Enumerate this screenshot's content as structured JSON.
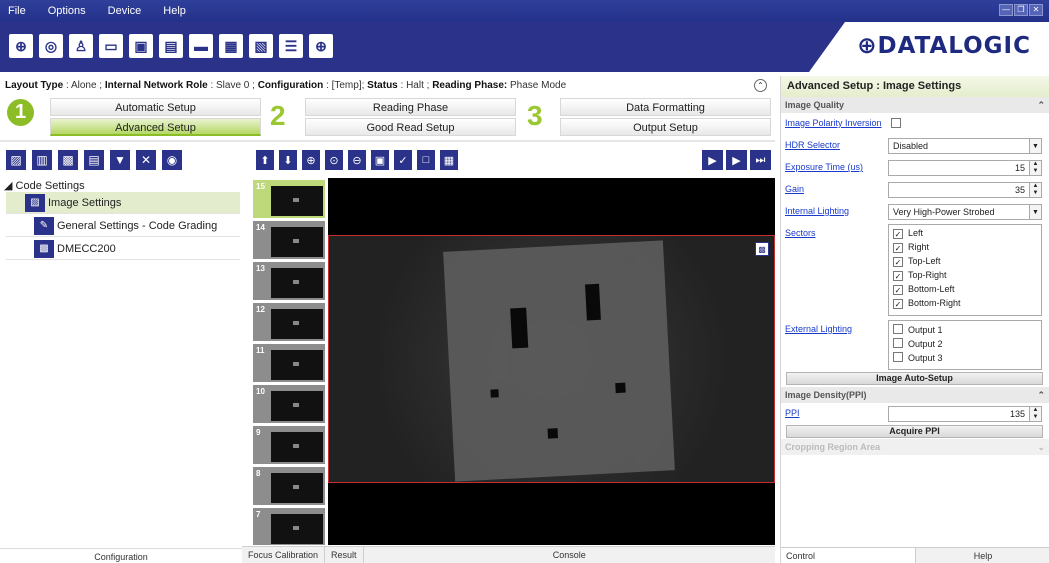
{
  "menu": [
    "File",
    "Options",
    "Device",
    "Help"
  ],
  "window_controls": [
    "—",
    "❐",
    "✕"
  ],
  "toolbar_icons": [
    "crosshair-icon",
    "search-device-icon",
    "user-icon",
    "window-icon",
    "camera-icon",
    "camera-search-icon",
    "monitor-icon",
    "device-icon",
    "device-config-icon",
    "statistics-icon",
    "target-icon"
  ],
  "logo": "⊕DATALOGIC",
  "infobar": {
    "layout_type_label": "Layout Type",
    "layout_type_value": ": Alone ;",
    "network_role_label": "Internal Network Role",
    "network_role_value": ": Slave 0 ;",
    "configuration_label": "Configuration",
    "configuration_value": ": [Temp];",
    "status_label": "Status",
    "status_value": ": Halt ;",
    "reading_phase_label": "Reading Phase:",
    "reading_phase_value": "Phase Mode"
  },
  "steps": {
    "n1": "1",
    "n2": "2",
    "n3": "3",
    "automatic_setup": "Automatic Setup",
    "advanced_setup": "Advanced Setup",
    "reading_phase": "Reading Phase",
    "good_read_setup": "Good Read Setup",
    "data_formatting": "Data Formatting",
    "output_setup": "Output Setup"
  },
  "tree": {
    "root": "◢ Code Settings",
    "items": [
      "Image Settings",
      "General Settings - Code Grading",
      "DMECC200"
    ]
  },
  "left_footer": "Configuration",
  "thumbs": [
    "15",
    "14",
    "13",
    "12",
    "11",
    "10",
    "9",
    "8",
    "7"
  ],
  "bottom_tabs": [
    "Focus Calibration",
    "Result",
    "Console"
  ],
  "right_panel": {
    "title": "Advanced Setup : Image Settings",
    "section_image_quality": "Image Quality",
    "polarity_label": "Image Polarity Inversion",
    "hdr_label": "HDR Selector",
    "hdr_value": "Disabled",
    "exposure_label": "Exposure Time (us)",
    "exposure_value": "15",
    "gain_label": "Gain",
    "gain_value": "35",
    "lighting_label": "Internal Lighting",
    "lighting_value": "Very High-Power Strobed",
    "sectors_label": "Sectors",
    "sectors": [
      "Left",
      "Right",
      "Top-Left",
      "Top-Right",
      "Bottom-Left",
      "Bottom-Right"
    ],
    "ext_lighting_label": "External Lighting",
    "outputs": [
      "Output 1",
      "Output 2",
      "Output 3"
    ],
    "auto_setup_btn": "Image Auto-Setup",
    "section_density": "Image Density(PPI)",
    "ppi_label": "PPI",
    "ppi_value": "135",
    "acquire_btn": "Acquire PPI",
    "section_cropping": "Cropping Region Area",
    "footer_control": "Control",
    "footer_help": "Help"
  }
}
